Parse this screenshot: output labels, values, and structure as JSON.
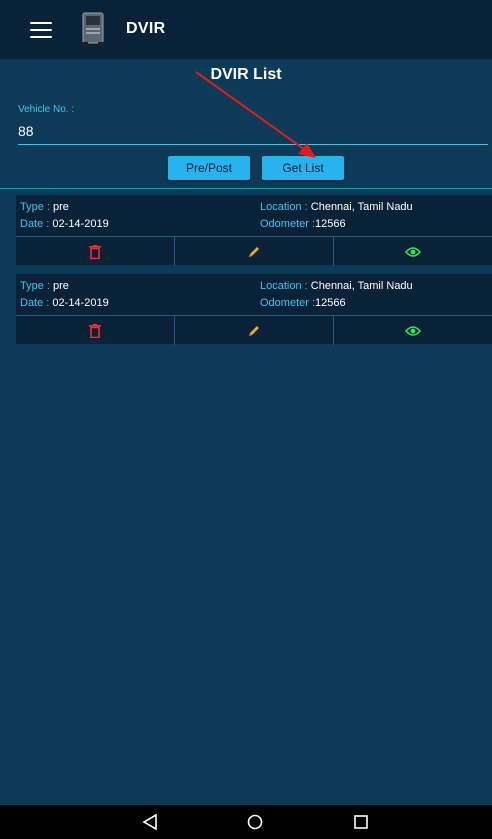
{
  "appbar": {
    "title": "DVIR",
    "menu_icon": "hamburger-menu-icon",
    "logo_icon": "truck-icon"
  },
  "page": {
    "title": "DVIR List"
  },
  "vehicle": {
    "label": "Vehicle No. :",
    "value": "88"
  },
  "buttons": {
    "prepost": "Pre/Post",
    "getlist": "Get List"
  },
  "records": [
    {
      "type_label": "Type :",
      "type_value": " pre",
      "date_label": "Date :",
      "date_value": " 02-14-2019",
      "location_label": "Location :",
      "location_value": " Chennai, Tamil Nadu",
      "odometer_label": "Odometer :",
      "odometer_value": "12566"
    },
    {
      "type_label": "Type :",
      "type_value": " pre",
      "date_label": "Date :",
      "date_value": " 02-14-2019",
      "location_label": "Location :",
      "location_value": " Chennai, Tamil Nadu",
      "odometer_label": "Odometer :",
      "odometer_value": "12566"
    }
  ],
  "colors": {
    "accent": "#27b3ee",
    "delete": "#ff2a2a",
    "edit": "#f5a623",
    "view": "#2ee84a",
    "annotation": "#e31b1b"
  },
  "icons": [
    "trash-icon",
    "pencil-icon",
    "eye-icon",
    "back-triangle-icon",
    "home-circle-icon",
    "recents-square-icon"
  ]
}
